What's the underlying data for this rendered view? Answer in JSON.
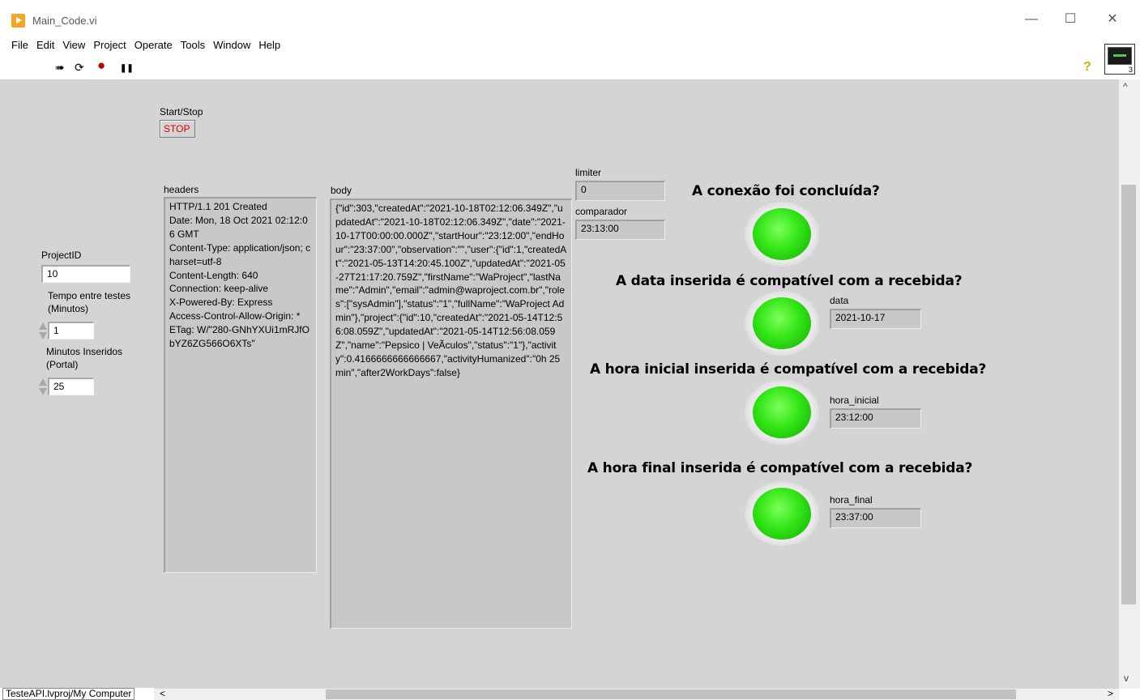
{
  "window": {
    "title": "Main_Code.vi",
    "minimize": "—",
    "maximize": "☐",
    "close": "✕"
  },
  "menu": [
    "File",
    "Edit",
    "View",
    "Project",
    "Operate",
    "Tools",
    "Window",
    "Help"
  ],
  "toolbar": {
    "run_icon": "➠",
    "run_continuous_icon": "⟳",
    "abort_icon": "●",
    "pause_icon": "❚❚",
    "help_icon": "?",
    "vi_icon_num": "3"
  },
  "status": {
    "project": "TesteAPI.lvproj/My Computer",
    "left_arrow": "<"
  },
  "scroll": {
    "up": "^",
    "down": "v",
    "right": ">"
  },
  "startstop": {
    "label": "Start/Stop",
    "button": "STOP"
  },
  "project": {
    "label": "ProjectID",
    "value": "10"
  },
  "tempo": {
    "label": "Tempo entre testes\n(Minutos)",
    "value": "1"
  },
  "minutos": {
    "label": "Minutos Inseridos\n(Portal)",
    "value": "25"
  },
  "headers": {
    "label": "headers",
    "value": "HTTP/1.1 201 Created\nDate: Mon, 18 Oct 2021 02:12:06 GMT\nContent-Type: application/json; charset=utf-8\nContent-Length: 640\nConnection: keep-alive\nX-Powered-By: Express\nAccess-Control-Allow-Origin: *\nETag: W/\"280-GNhYXUi1mRJfObYZ6ZG566O6XTs\""
  },
  "body": {
    "label": "body",
    "value": "{\"id\":303,\"createdAt\":\"2021-10-18T02:12:06.349Z\",\"updatedAt\":\"2021-10-18T02:12:06.349Z\",\"date\":\"2021-10-17T00:00:00.000Z\",\"startHour\":\"23:12:00\",\"endHour\":\"23:37:00\",\"observation\":\"\",\"user\":{\"id\":1,\"createdAt\":\"2021-05-13T14:20:45.100Z\",\"updatedAt\":\"2021-05-27T21:17:20.759Z\",\"firstName\":\"WaProject\",\"lastName\":\"Admin\",\"email\":\"admin@waproject.com.br\",\"roles\":[\"sysAdmin\"],\"status\":\"1\",\"fullName\":\"WaProject Admin\"},\"project\":{\"id\":10,\"createdAt\":\"2021-05-14T12:56:08.059Z\",\"updatedAt\":\"2021-05-14T12:56:08.059Z\",\"name\":\"Pepsico | VeÃ­culos\",\"status\":\"1\"},\"activity\":0.4166666666666667,\"activityHumanized\":\"0h 25min\",\"after2WorkDays\":false}"
  },
  "limiter": {
    "label": "limiter",
    "value": "0"
  },
  "comparador": {
    "label": "comparador",
    "value": "23:13:00"
  },
  "q1": {
    "text": "A conexão foi concluída?",
    "led_on": true
  },
  "q2": {
    "text": "A data inserida é compatível com a recebida?",
    "led_on": true,
    "field_label": "data",
    "field_value": "2021-10-17"
  },
  "q3": {
    "text": "A hora inicial inserida é compatível com a recebida?",
    "led_on": true,
    "field_label": "hora_inicial",
    "field_value": "23:12:00"
  },
  "q4": {
    "text": "A hora final inserida é compatível com a recebida?",
    "led_on": true,
    "field_label": "hora_final",
    "field_value": "23:37:00"
  },
  "colors": {
    "led_on": "#33e617",
    "panel": "#d4d4d4",
    "stop_text": "#e00000"
  }
}
